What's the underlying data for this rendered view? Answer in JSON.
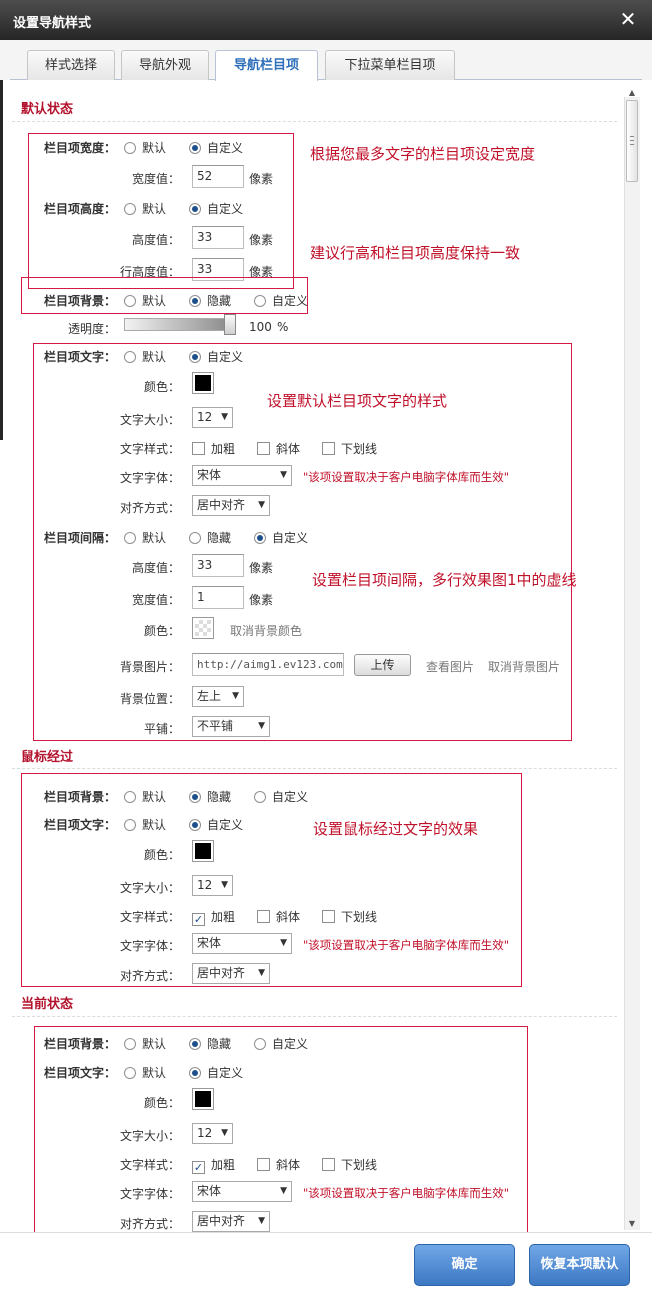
{
  "dialog": {
    "title": "设置导航样式"
  },
  "tabs": [
    "样式选择",
    "导航外观",
    "导航栏目项",
    "下拉菜单栏目项"
  ],
  "opts": {
    "default": "默认",
    "custom": "自定义",
    "hidden": "隐藏"
  },
  "units": {
    "px": "像素",
    "percent": "%"
  },
  "font_note": "\"该项设置取决于客户电脑字体库而生效\"",
  "sections": {
    "default": "默认状态",
    "hover": "鼠标经过",
    "current": "当前状态"
  },
  "default_state": {
    "width_label": "栏目项宽度：",
    "width_value_label": "宽度值：",
    "width_value": "52",
    "height_label": "栏目项高度：",
    "height_value_label": "高度值：",
    "height_value": "33",
    "line_height_label": "行高度值：",
    "line_height_value": "33",
    "bg_label": "栏目项背景：",
    "opacity_label": "透明度：",
    "opacity_value": "100",
    "text_label": "栏目项文字：",
    "color_label": "颜色：",
    "size_label": "文字大小：",
    "size_value": "12",
    "style_label": "文字样式：",
    "bold": "加粗",
    "italic": "斜体",
    "underline": "下划线",
    "font_label": "文字字体：",
    "font_value": "宋体",
    "align_label": "对齐方式：",
    "align_value": "居中对齐",
    "sep_label": "栏目项间隔：",
    "sep_height_label": "高度值：",
    "sep_height_value": "33",
    "sep_width_label": "宽度值：",
    "sep_width_value": "1",
    "sep_color_label": "颜色：",
    "cancel_bg_color": "取消背景颜色",
    "bg_image_label": "背景图片：",
    "bg_image_url": "http://aimg1.ev123.com",
    "upload": "上传",
    "view_image": "查看图片",
    "cancel_bg_image": "取消背景图片",
    "bg_pos_label": "背景位置：",
    "bg_pos_value": "左上",
    "tile_label": "平铺：",
    "tile_value": "不平铺"
  },
  "annotations": {
    "a1": "根据您最多文字的栏目项设定宽度",
    "a2": "建议行高和栏目项高度保持一致",
    "a3": "设置默认栏目项文字的样式",
    "a4": "设置栏目项间隔，多行效果图1中的虚线",
    "a5": "设置鼠标经过文字的效果"
  },
  "hover_state": {
    "bg_label": "栏目项背景：",
    "text_label": "栏目项文字：",
    "color_label": "颜色：",
    "size_label": "文字大小：",
    "size_value": "12",
    "style_label": "文字样式：",
    "bold": "加粗",
    "italic": "斜体",
    "underline": "下划线",
    "font_label": "文字字体：",
    "font_value": "宋体",
    "align_label": "对齐方式：",
    "align_value": "居中对齐"
  },
  "current_state": {
    "bg_label": "栏目项背景：",
    "text_label": "栏目项文字：",
    "color_label": "颜色：",
    "size_label": "文字大小：",
    "size_value": "12",
    "style_label": "文字样式：",
    "bold": "加粗",
    "italic": "斜体",
    "underline": "下划线",
    "font_label": "文字字体：",
    "font_value": "宋体",
    "align_label": "对齐方式：",
    "align_value": "居中对齐"
  },
  "buttons": {
    "confirm": "确定",
    "restore": "恢复本项默认"
  },
  "colors": {
    "accent": "#b3122d",
    "annotation": "#c0102a",
    "button": "#3d78c4",
    "text_color": "#000000"
  },
  "icons": {
    "close": "close-icon",
    "radio": "radio-icon",
    "checkbox": "checkbox-icon",
    "dropdown": "chevron-down-icon"
  }
}
